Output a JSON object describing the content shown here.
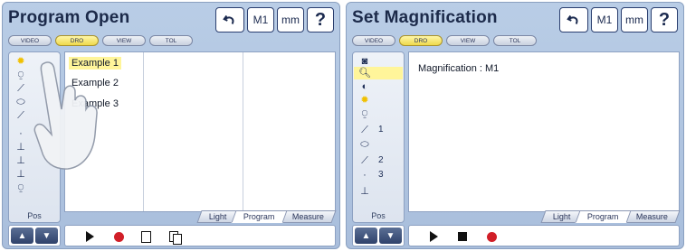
{
  "left": {
    "title": "Program Open",
    "top_buttons": {
      "undo": "↶",
      "m1": "M1",
      "mm": "mm",
      "help": "?"
    },
    "tabs": [
      "VIDEO",
      "DRO",
      "VIEW",
      "TOL"
    ],
    "active_tab": "DRO",
    "sidebar": {
      "icons": [
        "sun-icon",
        "probe-icon",
        "line-icon",
        "circle-icon",
        "point-icon",
        "distance-icon",
        "angle-icon",
        "cross-icon",
        "crosshair-icon",
        "probe-icon"
      ],
      "pos_label": "Pos"
    },
    "list": [
      "Example 1",
      "Example 2",
      "Example 3"
    ],
    "selected_item": "Example 1",
    "bottom_tabs": [
      "Light",
      "Program",
      "Measure"
    ],
    "active_bottom_tab": "Program",
    "controls": [
      "play-icon",
      "record-icon",
      "document-icon",
      "copy-icon"
    ]
  },
  "right": {
    "title": "Set Magnification",
    "top_buttons": {
      "undo": "↶",
      "m1": "M1",
      "mm": "mm",
      "help": "?"
    },
    "tabs": [
      "VIDEO",
      "DRO",
      "VIEW",
      "TOL"
    ],
    "active_tab": "DRO",
    "sidebar": {
      "icons": [
        "camera-icon",
        "magnify-icon",
        "contrast-icon",
        "sun-icon",
        "probe-icon",
        "line-icon",
        "circle-icon",
        "line-icon",
        "point-icon",
        "cross-icon"
      ],
      "numbers": [
        "1",
        "2",
        "3"
      ],
      "pos_label": "Pos"
    },
    "magnification_text": "Magnification : M1",
    "bottom_tabs": [
      "Light",
      "Program",
      "Measure"
    ],
    "active_bottom_tab": "Program",
    "controls": [
      "play-icon",
      "stop-icon",
      "record-icon"
    ]
  },
  "colors": {
    "panel_blue": "#b9cde6",
    "highlight_yellow": "#fff59a",
    "record_red": "#d11f28",
    "text_navy": "#1c2a4a"
  }
}
